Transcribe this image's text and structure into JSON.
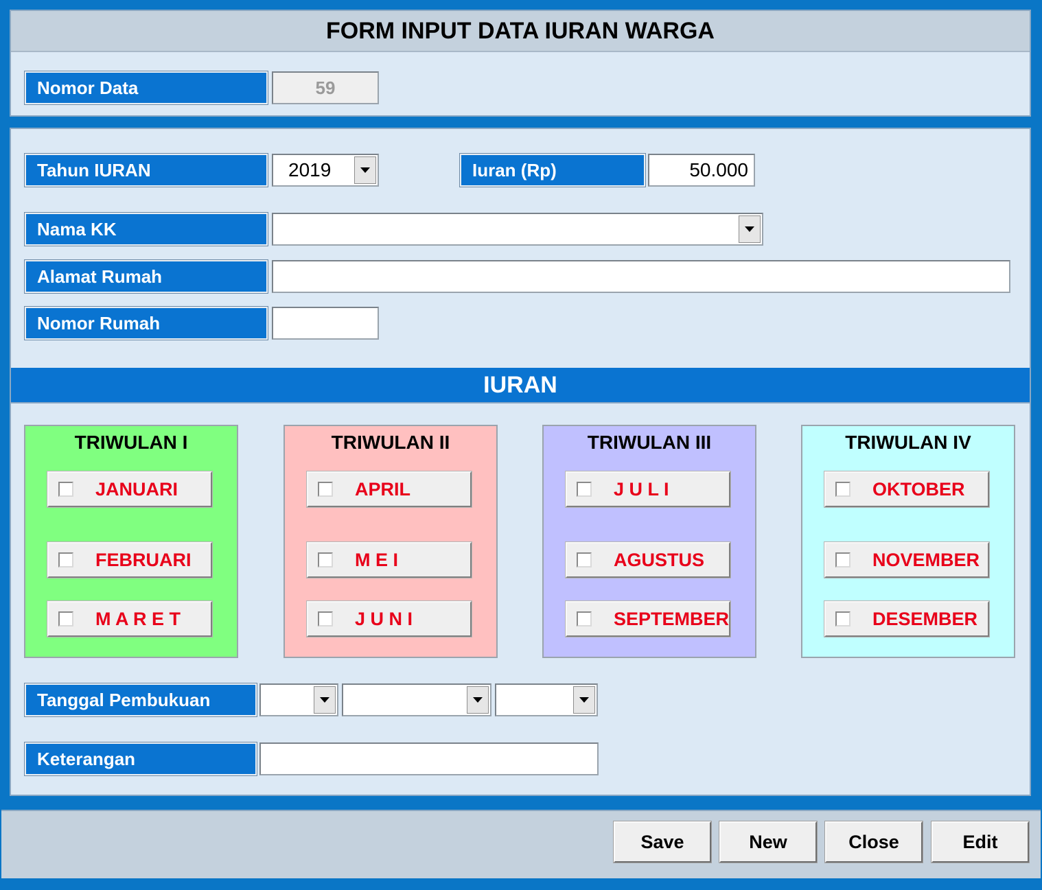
{
  "form": {
    "title": "FORM INPUT DATA IURAN WARGA",
    "nomor_data": {
      "label": "Nomor Data",
      "value": "59"
    },
    "tahun_iuran": {
      "label": "Tahun IURAN",
      "value": "2019"
    },
    "iuran_rp": {
      "label": "Iuran (Rp)",
      "value": "50.000"
    },
    "nama_kk": {
      "label": "Nama KK",
      "value": ""
    },
    "alamat_rumah": {
      "label": "Alamat Rumah",
      "value": ""
    },
    "nomor_rumah": {
      "label": "Nomor Rumah",
      "value": ""
    },
    "section_title": "IURAN",
    "quarters": [
      {
        "title": "TRIWULAN I",
        "color": "#80ff80",
        "months": [
          "JANUARI",
          "FEBRUARI",
          "M A R E T"
        ]
      },
      {
        "title": "TRIWULAN II",
        "color": "#ffc0c0",
        "months": [
          "APRIL",
          "M E I",
          "J U N I"
        ]
      },
      {
        "title": "TRIWULAN III",
        "color": "#c0c0ff",
        "months": [
          "J U L I",
          "AGUSTUS",
          "SEPTEMBER"
        ]
      },
      {
        "title": "TRIWULAN IV",
        "color": "#c0ffff",
        "months": [
          "OKTOBER",
          "NOVEMBER",
          "DESEMBER"
        ]
      }
    ],
    "tanggal_pembukuan": {
      "label": "Tanggal Pembukuan",
      "day": "",
      "month": "",
      "year": ""
    },
    "keterangan": {
      "label": "Keterangan",
      "value": ""
    }
  },
  "buttons": {
    "save": "Save",
    "new": "New",
    "close": "Close",
    "edit": "Edit"
  },
  "colors": {
    "accent": "#0a74d1",
    "panel": "#dce9f5",
    "month_text": "#e8001a"
  }
}
